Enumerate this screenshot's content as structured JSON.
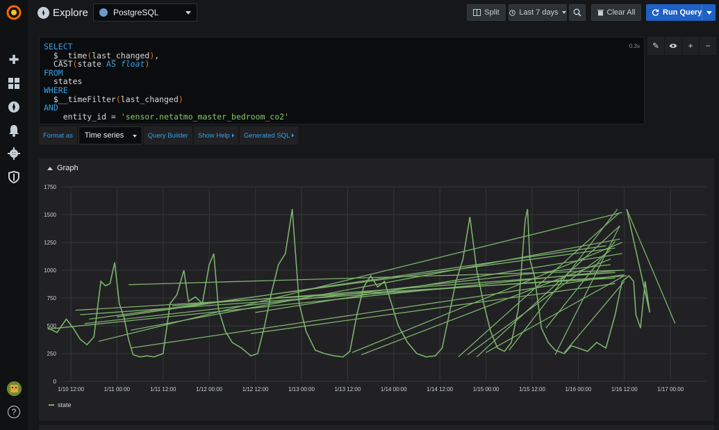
{
  "app": {
    "title": "Explore"
  },
  "datasource": {
    "name": "PostgreSQL"
  },
  "toolbar": {
    "split_label": "Split",
    "time_range_label": "Last 7 days",
    "clear_label": "Clear All",
    "run_label": "Run Query"
  },
  "query": {
    "lines": [
      "SELECT",
      "  $__time(last_changed),",
      "  CAST(state AS float)",
      "FROM",
      "  states",
      "WHERE",
      "  $__timeFilter(last_changed)",
      "AND",
      "    entity_id = 'sensor.netatmo_master_bedroom_co2'"
    ],
    "elapsed": "0.3s"
  },
  "query_options": {
    "format_label": "Format as",
    "format_value": "Time series",
    "builder_label": "Query Builder",
    "help_label": "Show Help",
    "sql_label": "Generated SQL"
  },
  "graph": {
    "title": "Graph"
  },
  "colors": {
    "series": "#7eb26d",
    "accent": "#1f60c4",
    "keyword": "#33a2e5",
    "string": "#8ac66a"
  },
  "chart_data": {
    "type": "line",
    "title": "",
    "ylim": [
      0,
      1750
    ],
    "yticks": [
      0,
      250,
      500,
      750,
      1000,
      1250,
      1500,
      1750
    ],
    "xticks": [
      "1/10 12:00",
      "1/11 00:00",
      "1/11 12:00",
      "1/12 00:00",
      "1/12 12:00",
      "1/13 00:00",
      "1/13 12:00",
      "1/14 00:00",
      "1/14 12:00",
      "1/15 00:00",
      "1/15 12:00",
      "1/16 00:00",
      "1/16 12:00",
      "1/17 00:00"
    ],
    "grid": true,
    "legend_position": "bottom-left",
    "series": [
      {
        "name": "state",
        "points": [
          [
            -0.5,
            480
          ],
          [
            -0.3,
            440
          ],
          [
            -0.1,
            560
          ],
          [
            0.05,
            480
          ],
          [
            0.2,
            380
          ],
          [
            0.35,
            330
          ],
          [
            0.5,
            400
          ],
          [
            0.65,
            900
          ],
          [
            0.75,
            860
          ],
          [
            0.85,
            880
          ],
          [
            0.95,
            1070
          ],
          [
            1.05,
            700
          ],
          [
            1.15,
            580
          ],
          [
            1.25,
            380
          ],
          [
            1.35,
            240
          ],
          [
            1.5,
            220
          ],
          [
            1.65,
            230
          ],
          [
            1.8,
            220
          ],
          [
            2.0,
            250
          ],
          [
            2.15,
            700
          ],
          [
            2.3,
            780
          ],
          [
            2.45,
            1000
          ],
          [
            2.55,
            720
          ],
          [
            2.7,
            760
          ],
          [
            2.85,
            700
          ],
          [
            3.0,
            1050
          ],
          [
            3.1,
            1150
          ],
          [
            3.2,
            650
          ],
          [
            3.35,
            450
          ],
          [
            3.5,
            350
          ],
          [
            3.7,
            300
          ],
          [
            3.9,
            230
          ],
          [
            4.05,
            250
          ],
          [
            4.2,
            500
          ],
          [
            4.35,
            800
          ],
          [
            4.5,
            1050
          ],
          [
            4.65,
            1150
          ],
          [
            4.8,
            1550
          ],
          [
            4.95,
            700
          ],
          [
            5.1,
            450
          ],
          [
            5.3,
            280
          ],
          [
            5.5,
            250
          ],
          [
            5.7,
            230
          ],
          [
            5.9,
            220
          ],
          [
            6.05,
            270
          ],
          [
            6.2,
            600
          ],
          [
            6.35,
            850
          ],
          [
            6.5,
            950
          ],
          [
            6.65,
            850
          ],
          [
            6.8,
            900
          ],
          [
            6.95,
            700
          ],
          [
            7.1,
            500
          ],
          [
            7.3,
            350
          ],
          [
            7.5,
            250
          ],
          [
            7.7,
            220
          ],
          [
            7.9,
            230
          ],
          [
            8.05,
            300
          ],
          [
            8.2,
            600
          ],
          [
            8.35,
            900
          ],
          [
            8.5,
            1100
          ],
          [
            8.65,
            1480
          ],
          [
            8.8,
            1000
          ],
          [
            8.95,
            700
          ],
          [
            9.1,
            450
          ],
          [
            9.25,
            300
          ],
          [
            9.4,
            270
          ],
          [
            9.55,
            350
          ],
          [
            9.7,
            650
          ],
          [
            9.85,
            1450
          ],
          [
            9.9,
            1550
          ],
          [
            9.95,
            1100
          ],
          [
            10.05,
            950
          ],
          [
            10.2,
            480
          ],
          [
            10.35,
            350
          ],
          [
            10.5,
            280
          ],
          [
            10.7,
            250
          ],
          [
            10.85,
            320
          ],
          [
            11.0,
            300
          ],
          [
            11.2,
            270
          ],
          [
            11.4,
            350
          ],
          [
            11.6,
            300
          ],
          [
            11.8,
            600
          ],
          [
            11.95,
            900
          ],
          [
            12.1,
            950
          ],
          [
            12.2,
            900
          ],
          [
            12.25,
            600
          ],
          [
            12.35,
            480
          ],
          [
            12.45,
            900
          ],
          [
            12.55,
            620
          ],
          [
            12.05,
            1550
          ]
        ]
      }
    ]
  }
}
